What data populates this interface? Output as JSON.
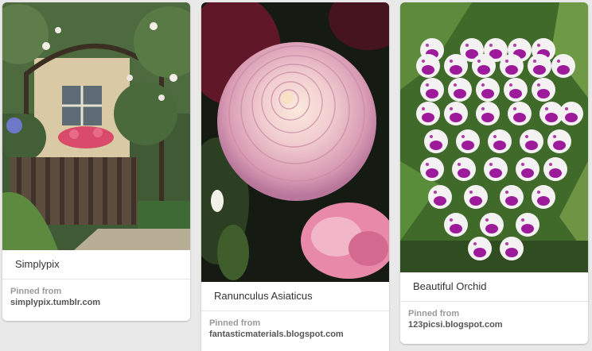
{
  "pins": [
    {
      "description": "Simplypix",
      "pinned_from_label": "Pinned from",
      "source": "simplypix.tumblr.com"
    },
    {
      "description": "Ranunculus Asiaticus",
      "pinned_from_label": "Pinned from",
      "source": "fantasticmaterials.blogspot.com"
    },
    {
      "description": "Beautiful Orchid",
      "pinned_from_label": "Pinned from",
      "source": "123picsi.blogspot.com"
    }
  ]
}
